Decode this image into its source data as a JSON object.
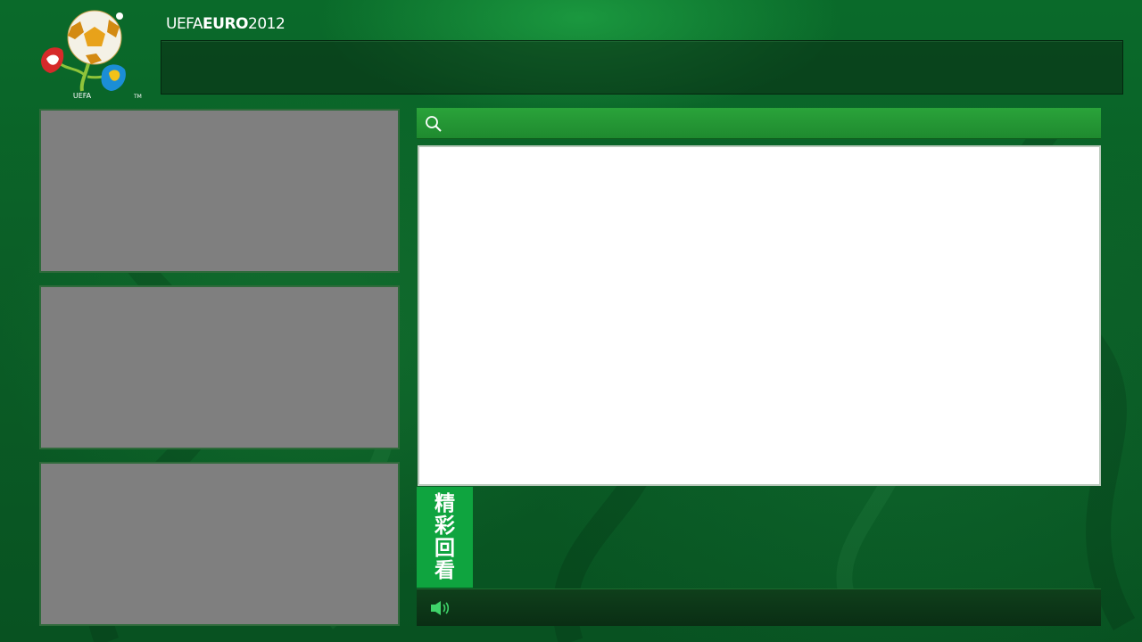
{
  "header": {
    "brand_prefix": "UEFA",
    "brand_bold": "EURO",
    "brand_year": "2012",
    "logo_text": "UEFA",
    "trademark": "TM"
  },
  "search": {
    "icon": "search-icon",
    "placeholder": ""
  },
  "replay": {
    "chars": [
      "精",
      "彩",
      "回",
      "看"
    ]
  },
  "bottom_bar": {
    "icon": "speaker-icon"
  },
  "colors": {
    "background": "#0b5f27",
    "accent_green": "#0fa43f",
    "thumbnail_gray": "#7f7f7f",
    "search_bar": "#2aa33a"
  }
}
